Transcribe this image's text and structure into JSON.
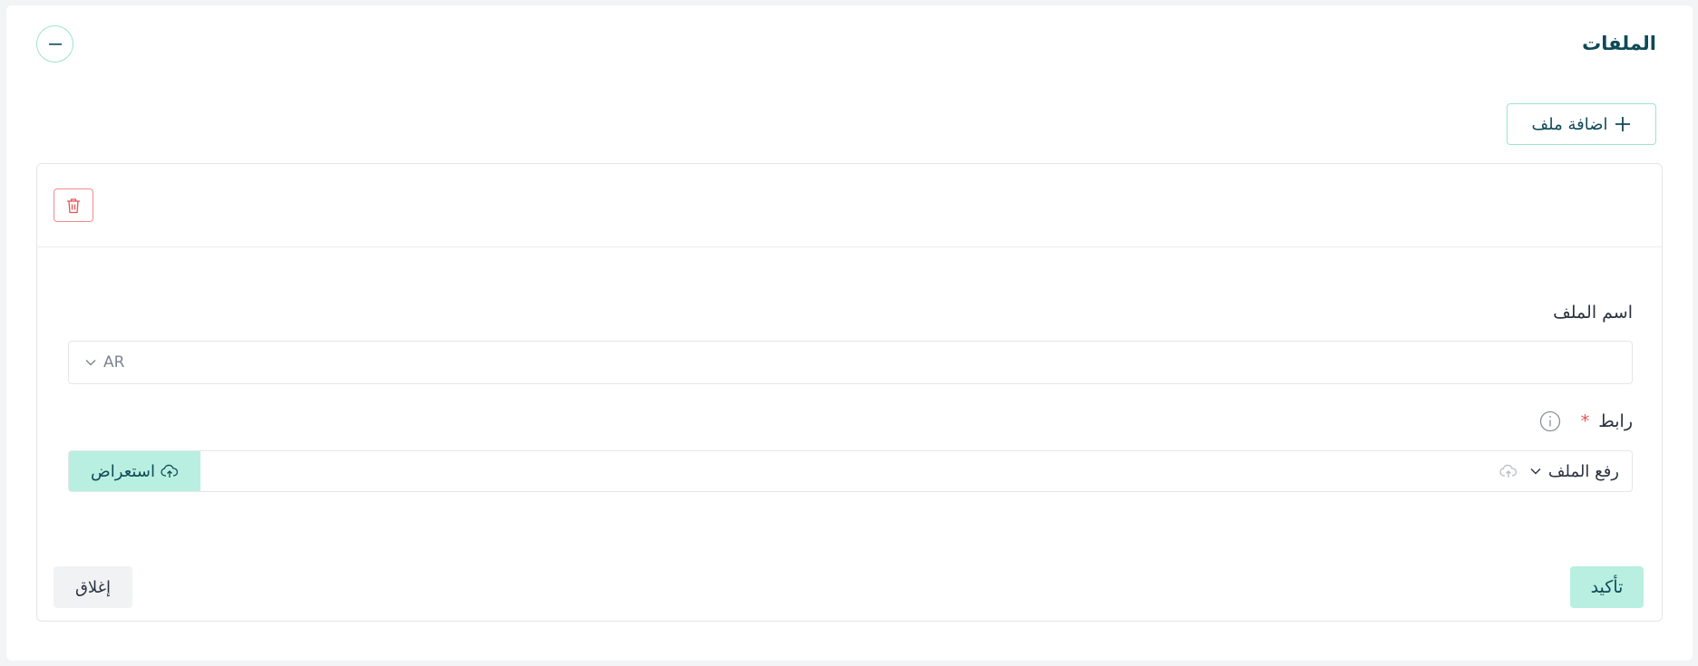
{
  "section": {
    "title": "الملفات"
  },
  "actions": {
    "add_file_label": "اضافة ملف"
  },
  "file_card": {
    "name_field": {
      "label": "اسم الملف",
      "language": "AR"
    },
    "link_field": {
      "label": "رابط",
      "required_mark": "*",
      "upload_option": "رفع الملف",
      "browse_label": "استعراض"
    },
    "footer": {
      "confirm_label": "تأكيد",
      "close_label": "إغلاق"
    }
  },
  "icons": {
    "collapse": "minus-circle-icon",
    "add": "plus-icon",
    "delete": "trash-icon",
    "info": "info-icon",
    "upload": "cloud-upload-icon",
    "dropdown": "chevron-down-icon"
  },
  "colors": {
    "accent": "#b8efe0",
    "accent_border": "#9be3cf",
    "danger": "#f08b8b",
    "title": "#0f4a57"
  }
}
